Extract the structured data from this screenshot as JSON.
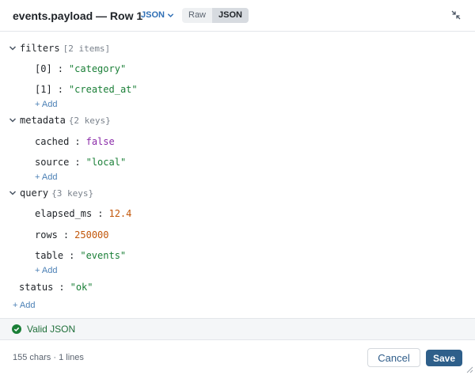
{
  "header": {
    "title": "events.payload — Row 1",
    "format": "JSON",
    "modes": [
      "Raw",
      "JSON"
    ],
    "active_mode": "JSON"
  },
  "tree": {
    "filters": {
      "key": "filters",
      "meta": "[2 items]",
      "items": [
        {
          "key": "[0]",
          "value": "\"category\""
        },
        {
          "key": "[1]",
          "value": "\"created_at\""
        }
      ]
    },
    "metadata": {
      "key": "metadata",
      "meta": "{2 keys}",
      "items": [
        {
          "key": "cached",
          "value": "false"
        },
        {
          "key": "source",
          "value": "\"local\""
        }
      ]
    },
    "query": {
      "key": "query",
      "meta": "{3 keys}",
      "items": [
        {
          "key": "elapsed_ms",
          "value": "12.4"
        },
        {
          "key": "rows",
          "value": "250000"
        },
        {
          "key": "table",
          "value": "\"events\""
        }
      ]
    },
    "status": {
      "key": "status",
      "value": "\"ok\""
    },
    "add_label": "+ Add"
  },
  "validation": {
    "text": "Valid JSON",
    "color": "#1a7f37"
  },
  "footer": {
    "counter": "155 chars · 1 lines",
    "cancel": "Cancel",
    "save": "Save"
  },
  "colors": {
    "accent": "#2e5f8a",
    "string": "#1a7f37",
    "bool": "#8a2aa8",
    "number": "#c2570a"
  }
}
